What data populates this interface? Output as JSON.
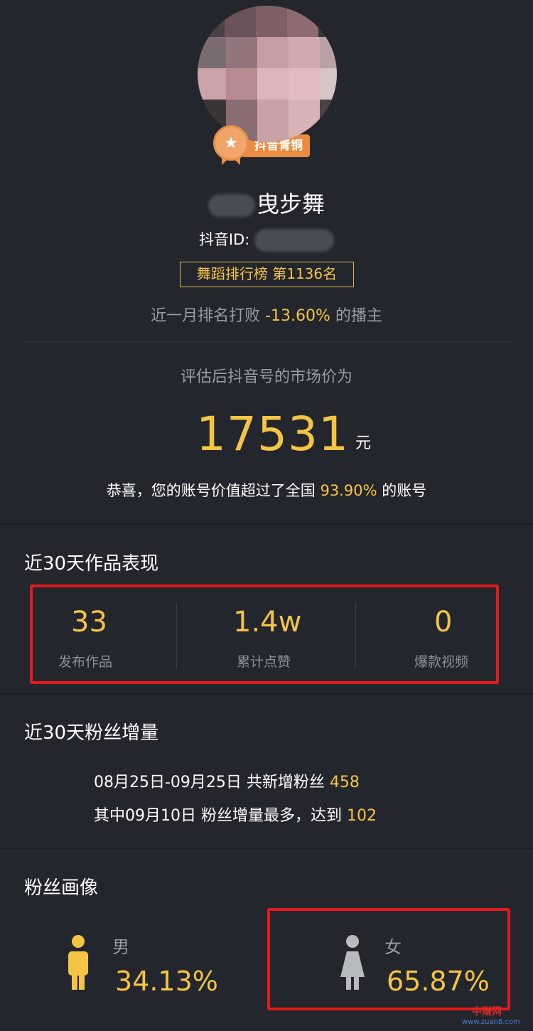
{
  "profile": {
    "badge_label": "抖音青铜",
    "name": "曳步舞",
    "id_label": "抖音ID: ",
    "rank_badge": "舞蹈排行榜 第1136名",
    "rank_prefix": "近一月排名打败 ",
    "rank_percent": "-13.60%",
    "rank_suffix": " 的播主"
  },
  "market": {
    "label": "评估后抖音号的市场价为",
    "value": "17531",
    "unit": "元",
    "congrats_prefix": "恭喜，您的账号价值超过了全国 ",
    "congrats_percent": "93.90%",
    "congrats_suffix": " 的账号"
  },
  "works": {
    "title": "近30天作品表现",
    "stats": [
      {
        "value": "33",
        "label": "发布作品"
      },
      {
        "value": "1.4w",
        "label": "累计点赞"
      },
      {
        "value": "0",
        "label": "爆款视频"
      }
    ]
  },
  "fans_growth": {
    "title": "近30天粉丝增量",
    "line1_prefix": "08月25日-09月25日 共新增粉丝 ",
    "line1_value": "458",
    "line2_prefix": "其中09月10日 粉丝增量最多，达到 ",
    "line2_value": "102"
  },
  "fans_portrait": {
    "title": "粉丝画像",
    "male": {
      "label": "男",
      "percent": "34.13%",
      "color": "#f4c443"
    },
    "female": {
      "label": "女",
      "percent": "65.87%",
      "color": "#b8babd"
    }
  },
  "watermark": {
    "text": "中赚网",
    "sub": "www.zuan8.com"
  },
  "colors": {
    "background": "#24262d",
    "accent": "#f4c443",
    "highlight": "#e4191b"
  }
}
